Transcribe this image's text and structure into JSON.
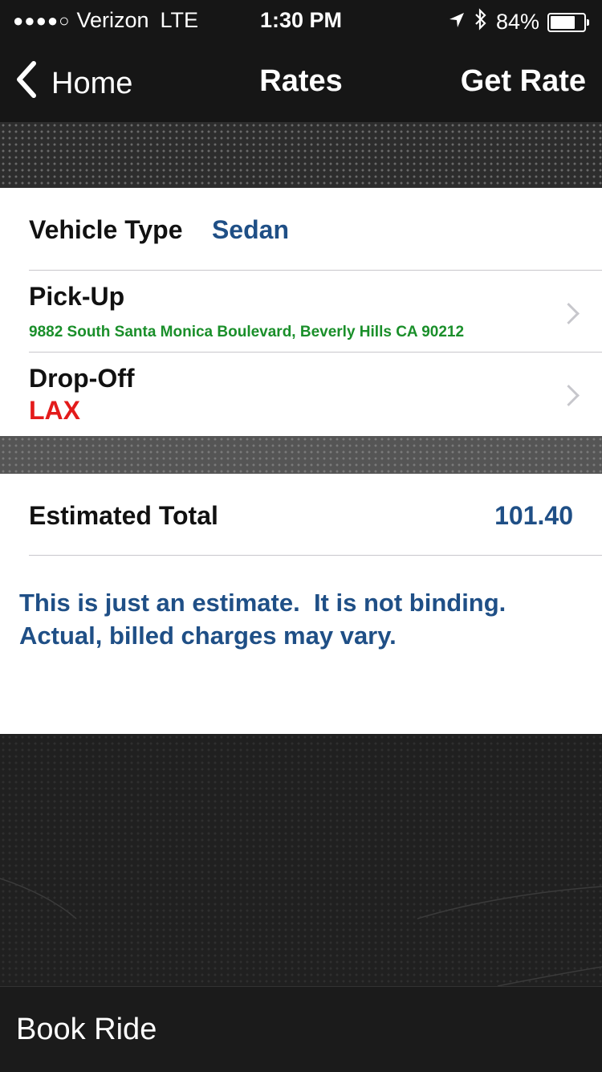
{
  "status_bar": {
    "signal_dots": "●●●●○",
    "carrier": "Verizon",
    "network": "LTE",
    "time": "1:30 PM",
    "location_icon": "location-arrow-icon",
    "bluetooth_icon": "bluetooth-icon",
    "battery_percent": "84%",
    "battery_level": 0.84
  },
  "nav": {
    "back_label": "Home",
    "title": "Rates",
    "action_label": "Get Rate"
  },
  "trip": {
    "vehicle_type_label": "Vehicle Type",
    "vehicle_type_value": "Sedan",
    "pickup_label": "Pick-Up",
    "pickup_value": "9882 South Santa Monica Boulevard, Beverly Hills CA 90212",
    "dropoff_label": "Drop-Off",
    "dropoff_value": "LAX"
  },
  "estimate": {
    "label": "Estimated Total",
    "value": "101.40",
    "disclaimer_line1": "This is just an estimate.  It is not binding.",
    "disclaimer_line2": "Actual, billed charges may vary."
  },
  "bottom_bar": {
    "book_label": "Book Ride"
  },
  "colors": {
    "accent_blue": "#1f4f86",
    "pickup_green": "#1a8f2a",
    "dropoff_red": "#e31b1b"
  }
}
